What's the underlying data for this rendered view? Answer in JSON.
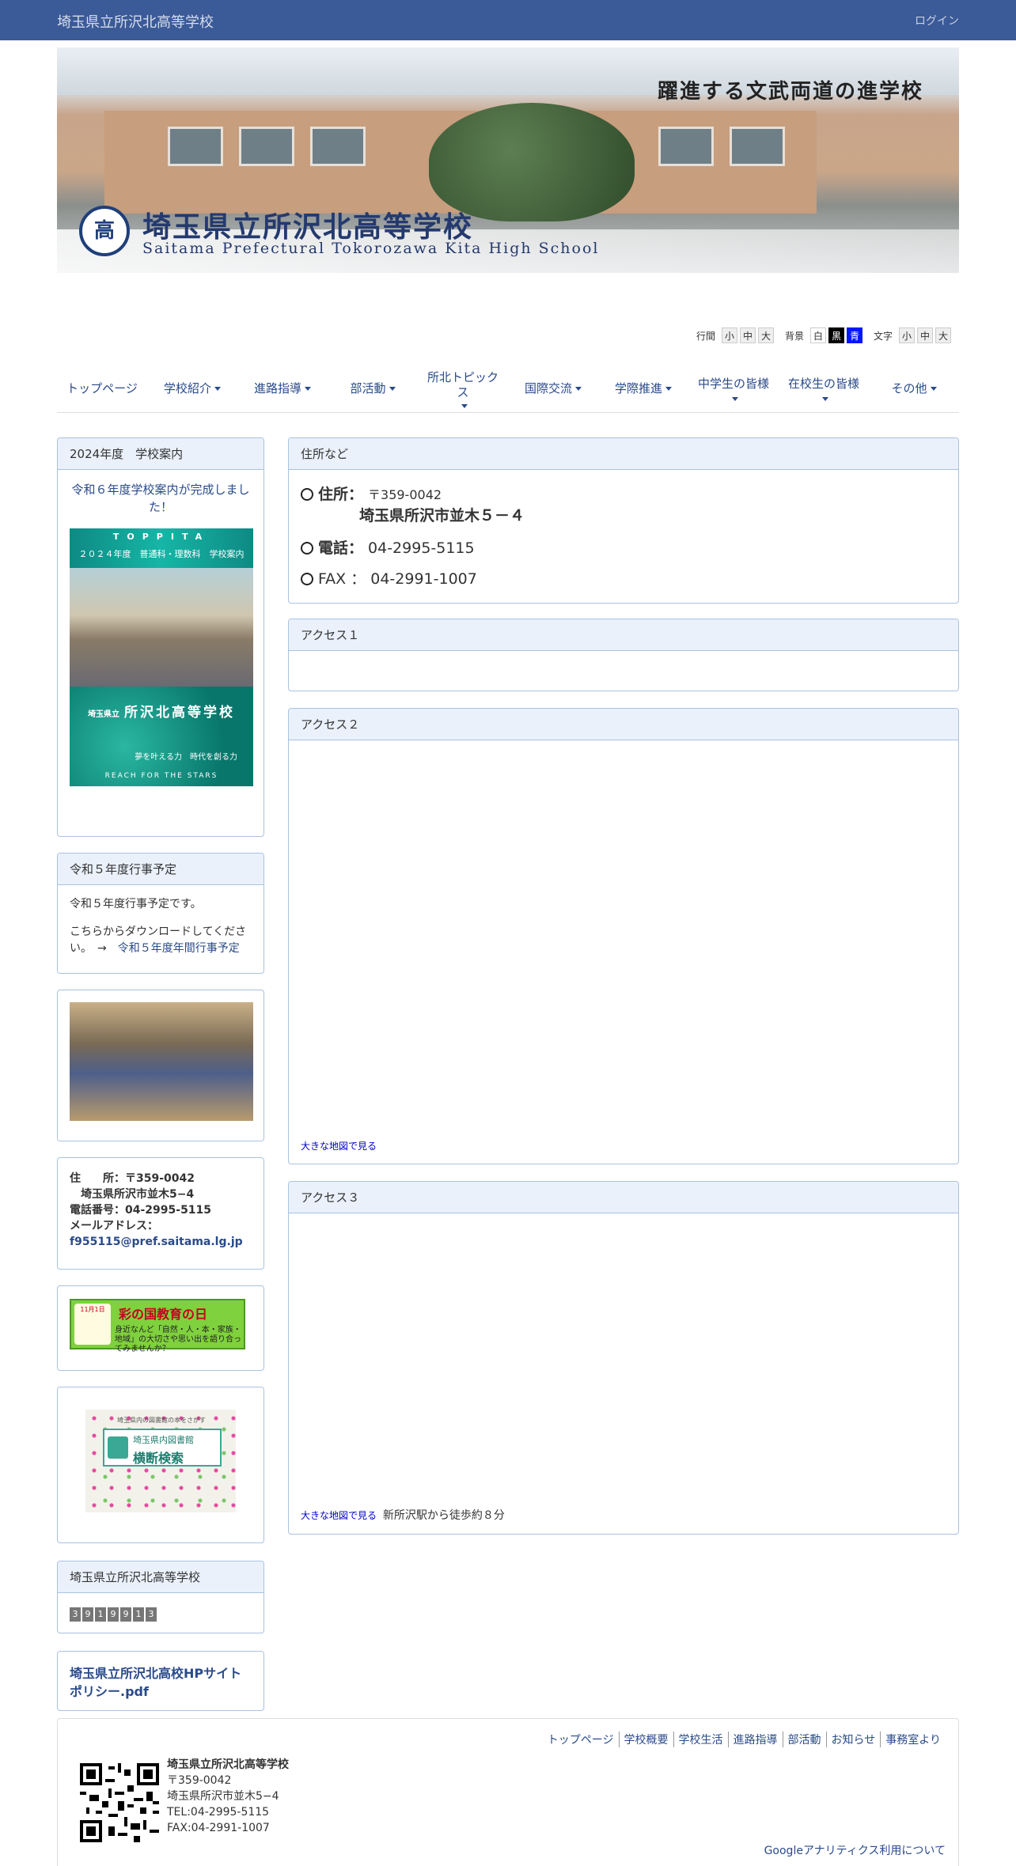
{
  "header": {
    "site_title": "埼玉県立所沢北高等学校",
    "login": "ログイン"
  },
  "banner": {
    "slogan": "躍進する文武両道の進学校",
    "emblem": "高",
    "name_ja": "埼玉県立所沢北高等学校",
    "name_en": "Saitama Prefectural Tokorozawa Kita High School"
  },
  "accessibility": {
    "line_label": "行間",
    "line": [
      "小",
      "中",
      "大"
    ],
    "bg_label": "背景",
    "bg": [
      "白",
      "黒",
      "青"
    ],
    "text_label": "文字",
    "text": [
      "小",
      "中",
      "大"
    ]
  },
  "nav": [
    {
      "label": "トップページ",
      "dropdown": false
    },
    {
      "label": "学校紹介",
      "dropdown": true
    },
    {
      "label": "進路指導",
      "dropdown": true
    },
    {
      "label": "部活動",
      "dropdown": true
    },
    {
      "label": "所北トピック\nス",
      "dropdown": true
    },
    {
      "label": "国際交流",
      "dropdown": true
    },
    {
      "label": "学際推進",
      "dropdown": true
    },
    {
      "label": "中学生の皆様",
      "dropdown": true
    },
    {
      "label": "在校生の皆様",
      "dropdown": true
    },
    {
      "label": "その他",
      "dropdown": true
    }
  ],
  "sidebar": {
    "guide": {
      "title": "2024年度　学校案内",
      "link": "令和６年度学校案内が完成しました！",
      "cover_top": "TOPPITA",
      "cover_sub": "２０２４年度　普通科・理数科　学校案内",
      "cover_school_prefix": "埼玉県立",
      "cover_school": "所沢北高等学校",
      "cover_tagline": "夢を叶える力　時代を創る力",
      "cover_en": "REACH FOR THE STARS"
    },
    "schedule": {
      "title": "令和５年度行事予定",
      "line1": "令和５年度行事予定です。",
      "line2": "こちらからダウンロードしてください。　→　",
      "link": "令和５年度年間行事予定"
    },
    "address": {
      "line1": "住　　所：〒359-0042",
      "line2": "　埼玉県所沢市並木5−4",
      "line3": "電話番号：04-2995-5115",
      "line4": "メールアドレス：",
      "email": "f955115@pref.saitama.lg.jp"
    },
    "edu_banner": {
      "date": "11月1日",
      "title": "彩の国教育の日",
      "desc": "身近なんど「自然・人・本・家族・地域」の大切さや思い出を語り合ってみませんか？"
    },
    "library_banner": {
      "l1": "埼玉県内の図書館の本をさがす",
      "l2": "埼玉県内図書館",
      "l3": "横断検索"
    },
    "counter": {
      "title": "埼玉県立所沢北高等学校",
      "digits": [
        "3",
        "9",
        "1",
        "9",
        "9",
        "1",
        "3"
      ]
    },
    "policy": "埼玉県立所沢北高校HPサイトポリシー.pdf"
  },
  "main": {
    "address_panel": {
      "title": "住所など",
      "addr_label": "住所：",
      "postal": "〒359-0042",
      "addr": "埼玉県所沢市並木５－４",
      "tel_label": "電話：",
      "tel": "04-2995-5115",
      "fax_label": "FAX ：",
      "fax": "04-2991-1007"
    },
    "access1": {
      "title": "アクセス１"
    },
    "access2": {
      "title": "アクセス２",
      "map_link": "大きな地図で見る"
    },
    "access3": {
      "title": "アクセス３",
      "map_link": "大きな地図で見る",
      "note": "新所沢駅から徒歩約８分"
    }
  },
  "footer": {
    "links": [
      "トップページ",
      "学校概要",
      "学校生活",
      "進路指導",
      "部活動",
      "お知らせ",
      "事務室より"
    ],
    "school": "埼玉県立所沢北高等学校",
    "postal": "〒359-0042",
    "addr": "埼玉県所沢市並木5−4",
    "tel": "TEL:04-2995-5115",
    "fax": "FAX:04-2991-1007",
    "ga": "Googleアナリティクス利用について"
  },
  "colors": {
    "header_bg": "#3b5a98",
    "panel_border": "#a9c2e3",
    "panel_head": "#eaf1fb",
    "link": "#2a4a8a"
  }
}
